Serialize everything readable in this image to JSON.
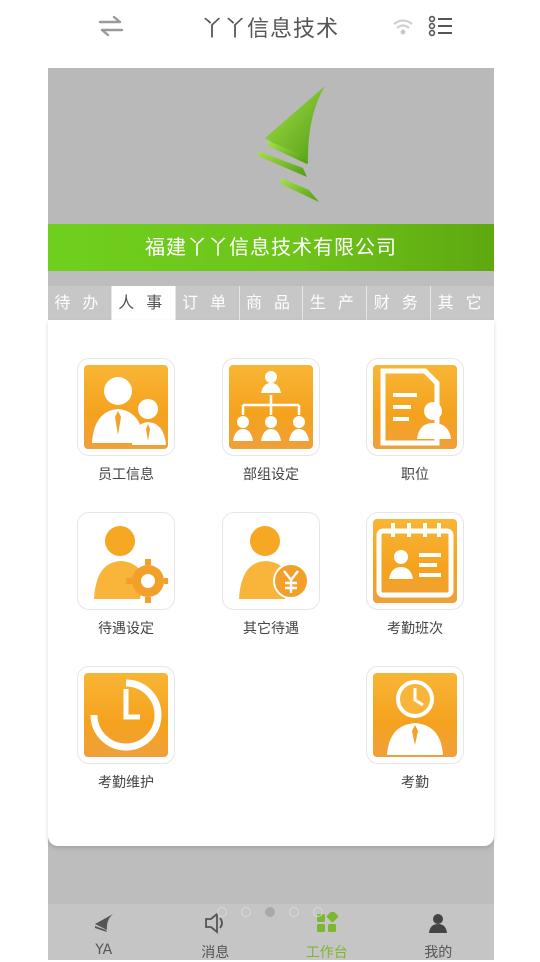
{
  "header": {
    "title": "丫丫信息技术",
    "left_icon": "swap-arrows-icon",
    "right_icons": [
      "wifi-icon",
      "list-menu-icon"
    ]
  },
  "banner": {
    "company_name": "福建丫丫信息技术有限公司",
    "logo_icon": "sail-logo-icon"
  },
  "tabs": [
    {
      "label": "待办",
      "active": false
    },
    {
      "label": "人事",
      "active": true
    },
    {
      "label": "订单",
      "active": false
    },
    {
      "label": "商品",
      "active": false
    },
    {
      "label": "生产",
      "active": false
    },
    {
      "label": "财务",
      "active": false
    },
    {
      "label": "其它",
      "active": false
    }
  ],
  "grid": [
    {
      "label": "员工信息",
      "icon": "employees-icon"
    },
    {
      "label": "部组设定",
      "icon": "org-chart-icon"
    },
    {
      "label": "职位",
      "icon": "position-document-icon"
    },
    {
      "label": "待遇设定",
      "icon": "user-gear-icon"
    },
    {
      "label": "其它待遇",
      "icon": "user-yen-icon"
    },
    {
      "label": "考勤班次",
      "icon": "calendar-card-icon"
    },
    {
      "label": "考勤维护",
      "icon": "clock-dial-icon"
    },
    {
      "label": "考勤",
      "icon": "user-clock-icon"
    }
  ],
  "pager": {
    "count": 5,
    "active_index": 2
  },
  "bottom_nav": [
    {
      "label": "YA",
      "icon": "ya-logo-icon",
      "active": false
    },
    {
      "label": "消息",
      "icon": "speaker-icon",
      "active": false
    },
    {
      "label": "工作台",
      "icon": "dashboard-grid-icon",
      "active": true
    },
    {
      "label": "我的",
      "icon": "person-icon",
      "active": false
    }
  ],
  "colors": {
    "accent_green": "#7cb82f",
    "tile_orange": "#f4a21e",
    "banner_green": "#6fcf1e"
  }
}
